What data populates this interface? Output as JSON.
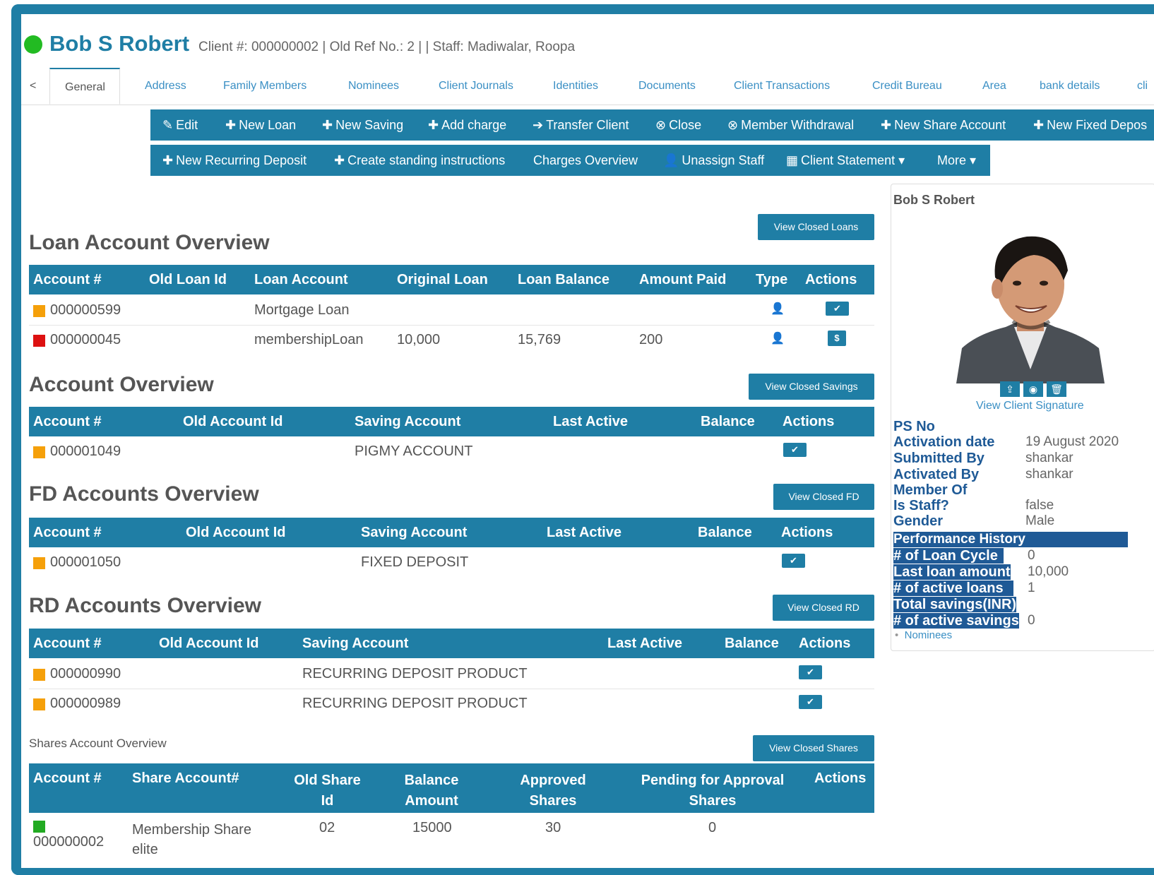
{
  "client": {
    "name": "Bob S Robert",
    "info": "Client #: 000000002 | Old Ref No.: 2 | | Staff: Madiwalar, Roopa"
  },
  "tabs": {
    "back": "<",
    "items": [
      "General",
      "Address",
      "Family Members",
      "Nominees",
      "Client Journals",
      "Identities",
      "Documents",
      "Client Transactions",
      "Credit Bureau",
      "Area",
      "bank details",
      "cli"
    ]
  },
  "toolbar1": [
    "Edit",
    "New Loan",
    "New Saving",
    "Add charge",
    "Transfer Client",
    "Close",
    "Member Withdrawal",
    "New Share Account",
    "New Fixed Depos"
  ],
  "toolbar2": [
    "New Recurring Deposit",
    "Create standing instructions",
    "Charges Overview",
    "Unassign Staff",
    "Client Statement",
    "More"
  ],
  "loans": {
    "title": "Loan Account Overview",
    "view_closed": "View Closed Loans",
    "headers": [
      "Account #",
      "Old Loan Id",
      "Loan Account",
      "Original Loan",
      "Loan Balance",
      "Amount Paid",
      "Type",
      "Actions"
    ],
    "rows": [
      {
        "account": "000000599",
        "old": "",
        "product": "Mortgage Loan",
        "original": "",
        "balance": "",
        "paid": "",
        "status_color": "#f5a00a",
        "action": "✔"
      },
      {
        "account": "000000045",
        "old": "",
        "product": "membershipLoan",
        "original": "10,000",
        "balance": "15,769",
        "paid": "200",
        "status_color": "#dd1111",
        "action": "$"
      }
    ]
  },
  "savings": {
    "title": "Account Overview",
    "view_closed": "View Closed Savings",
    "headers": [
      "Account #",
      "Old Account Id",
      "Saving Account",
      "Last Active",
      "Balance",
      "Actions"
    ],
    "rows": [
      {
        "account": "000001049",
        "product": "PIGMY ACCOUNT",
        "status_color": "#f5a00a"
      }
    ]
  },
  "fd": {
    "title": "FD Accounts Overview",
    "view_closed": "View Closed FD",
    "headers": [
      "Account #",
      "Old Account Id",
      "Saving Account",
      "Last Active",
      "Balance",
      "Actions"
    ],
    "rows": [
      {
        "account": "000001050",
        "product": "FIXED DEPOSIT",
        "status_color": "#f5a00a"
      }
    ]
  },
  "rd": {
    "title": "RD Accounts Overview",
    "view_closed": "View Closed RD",
    "headers": [
      "Account #",
      "Old Account Id",
      "Saving Account",
      "Last Active",
      "Balance",
      "Actions"
    ],
    "rows": [
      {
        "account": "000000990",
        "product": "RECURRING DEPOSIT PRODUCT",
        "status_color": "#f5a00a"
      },
      {
        "account": "000000989",
        "product": "RECURRING DEPOSIT PRODUCT",
        "status_color": "#f5a00a"
      }
    ]
  },
  "shares": {
    "title": "Shares Account Overview",
    "view_closed": "View Closed Shares",
    "headers": [
      "Account #",
      "Share Account#",
      "Old Share Id",
      "Balance Amount",
      "Approved Shares",
      "Pending for Approval Shares",
      "Actions"
    ],
    "row": {
      "account": "000000002",
      "product": "Membership Share elite",
      "old": "02",
      "balance": "15000",
      "approved": "30",
      "pending": "0",
      "status_color": "#22aa22"
    }
  },
  "profile": {
    "name": "Bob S Robert",
    "signature_link": "View Client Signature",
    "fields": [
      {
        "label": "PS No",
        "value": ""
      },
      {
        "label": "Activation date",
        "value": "19 August 2020"
      },
      {
        "label": "Submitted By",
        "value": "shankar"
      },
      {
        "label": "Activated By",
        "value": "shankar"
      },
      {
        "label": "Member Of",
        "value": ""
      },
      {
        "label": "Is Staff?",
        "value": "false"
      },
      {
        "label": "Gender",
        "value": "Male"
      }
    ],
    "perf_title": "Performance History",
    "perf": [
      {
        "label": "# of Loan Cycle",
        "value": "0"
      },
      {
        "label": "Last loan amount",
        "value": "10,000"
      },
      {
        "label": "# of active loans",
        "value": "1"
      },
      {
        "label": "Total savings(INR)",
        "value": ""
      },
      {
        "label": "# of active savings",
        "value": "0"
      }
    ],
    "nominees_link": "Nominees"
  },
  "colors": {
    "primary": "#1f7ea5",
    "label": "#1f5a96",
    "active": "#22bb22"
  }
}
